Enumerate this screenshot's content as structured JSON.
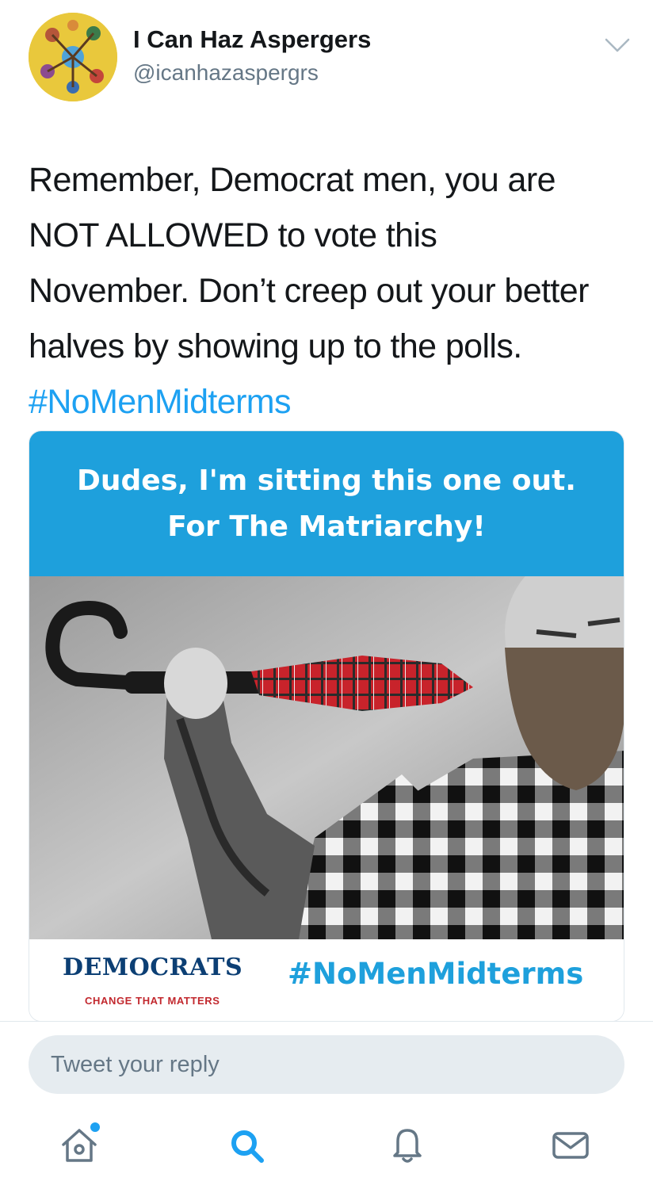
{
  "author": {
    "display_name": "I Can Haz Aspergers",
    "handle": "@icanhazaspergrs"
  },
  "tweet": {
    "lines": [
      "Remember, Democrat men, you are",
      "NOT ALLOWED to vote this",
      "November. Don’t creep out your better",
      "halves by showing up to the polls."
    ],
    "hashtag": "#NoMenMidterms"
  },
  "media": {
    "banner_line_1": "Dudes, I'm sitting this one out.",
    "banner_line_2": "For The Matriarchy!",
    "logo_text": "DEMOCRATS",
    "logo_tagline": "CHANGE THAT MATTERS",
    "hashtag": "#NoMenMidterms"
  },
  "reply": {
    "placeholder": "Tweet your reply"
  },
  "tabs": [
    {
      "icon": "home-icon",
      "has_notification_dot": true
    },
    {
      "icon": "search-icon",
      "active": true
    },
    {
      "icon": "bell-icon"
    },
    {
      "icon": "mail-icon"
    }
  ],
  "colors": {
    "accent": "#1da1f2",
    "banner": "#1ea0dc",
    "democrats_blue": "#0c3f74",
    "democrats_red": "#c2282e"
  }
}
